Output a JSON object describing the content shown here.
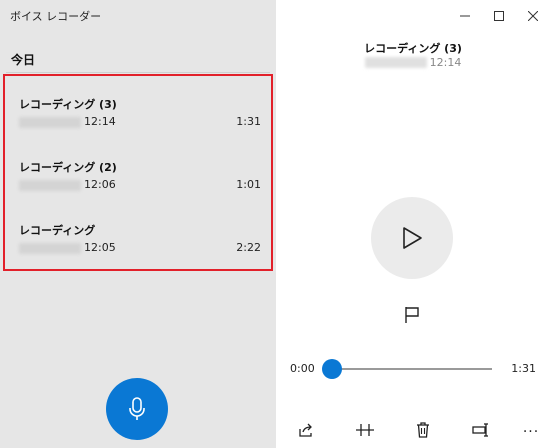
{
  "app": {
    "title": "ボイス レコーダー"
  },
  "list": {
    "section_header": "今日",
    "recordings": [
      {
        "name": "レコーディング (3)",
        "time": "12:14",
        "duration": "1:31"
      },
      {
        "name": "レコーディング (2)",
        "time": "12:06",
        "duration": "1:01"
      },
      {
        "name": "レコーディング",
        "time": "12:05",
        "duration": "2:22"
      }
    ]
  },
  "player": {
    "title": "レコーディング (3)",
    "time": "12:14",
    "position_label": "0:00",
    "duration_label": "1:31",
    "progress": 0
  },
  "toolbar": {
    "icons": [
      "share-icon",
      "trim-icon",
      "delete-icon",
      "rename-icon"
    ],
    "more_label": "..."
  },
  "colors": {
    "accent": "#0a78d4",
    "highlight_border": "#e2202a",
    "left_pane_bg": "#e6e6e6"
  }
}
